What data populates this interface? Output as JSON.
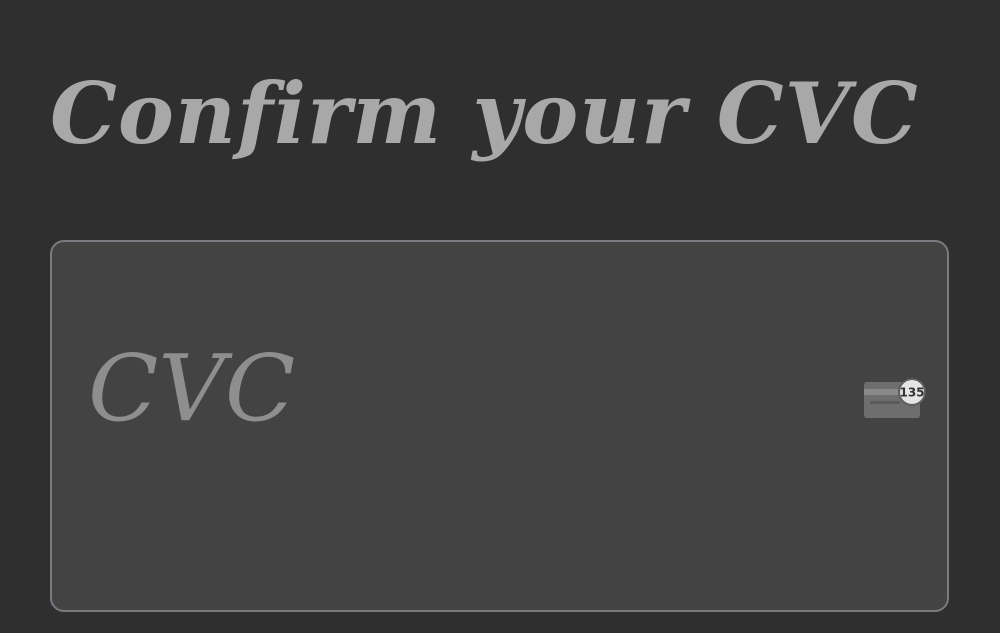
{
  "page": {
    "title": "Confirm your CVC"
  },
  "cvc_field": {
    "value": "",
    "placeholder": "CVC",
    "icon": "card-cvc-icon",
    "icon_badge": "135"
  },
  "colors": {
    "background": "#2f2f2f",
    "field_background": "#434343",
    "field_border": "#7a7a80",
    "text": "#a8a8a8"
  }
}
